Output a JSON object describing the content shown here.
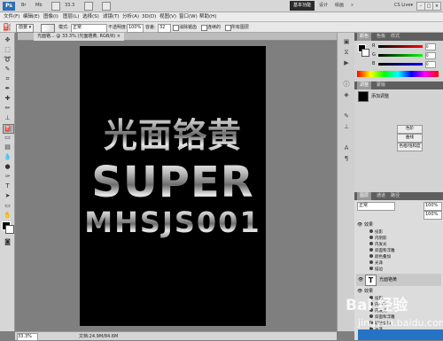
{
  "app": {
    "logo": "Ps",
    "top_buttons": [
      "Br",
      "Mb",
      "33.3",
      "▾",
      "▾",
      "▾"
    ],
    "workspace_active": "基本功能",
    "workspace_items": [
      "设计",
      "绘画",
      "»"
    ],
    "cs_live": "CS Live▾",
    "window_buttons": [
      "–",
      "□",
      "×"
    ]
  },
  "menu": [
    "文件(F)",
    "编辑(E)",
    "图像(I)",
    "图层(L)",
    "选择(S)",
    "滤镜(T)",
    "分析(A)",
    "3D(D)",
    "视图(V)",
    "窗口(W)",
    "帮助(H)"
  ],
  "options_bar": {
    "mode_label": "模式:",
    "mode_value": "正常",
    "opacity_label": "不透明度:",
    "opacity_value": "100%",
    "tolerance_label": "容差:",
    "tolerance_value": "32",
    "anti_alias": "消除锯齿",
    "contiguous": "连续的",
    "all_layers": "所有图层"
  },
  "doc_tab": {
    "title": "光面铬... @ 33.3% (光面铬黄, RGB/8) ×"
  },
  "canvas": {
    "line1": "光面铬黄",
    "line2": "SUPER",
    "line3": "MHSJS001"
  },
  "status": {
    "zoom": "33.3%",
    "doc": "文档:24.9M/84.6M"
  },
  "panels": {
    "color": {
      "tabs": [
        "颜色",
        "色板",
        "样式"
      ],
      "channels": [
        {
          "label": "R",
          "value": "0"
        },
        {
          "label": "G",
          "value": "0"
        },
        {
          "label": "B",
          "value": "0"
        }
      ]
    },
    "adjust": {
      "tabs": [
        "调整",
        "蒙版"
      ],
      "title": "添加调整",
      "buttons": [
        "色阶",
        "曲线",
        "色相/饱和度"
      ]
    },
    "layers": {
      "tabs": [
        "图层",
        "通道",
        "路径"
      ],
      "blend": "正常",
      "opacity": "100%",
      "fill": "100%",
      "effects_label": "效果",
      "layer1_fx": [
        "投影",
        "内阴影",
        "内发光",
        "斜面和浮雕",
        "颜色叠加",
        "光泽",
        "描边"
      ],
      "text_layer_name": "光面铬黄",
      "layer2_fx": [
        "投影",
        "内阴影",
        "内发光",
        "斜面和浮雕",
        "颜色叠加",
        "光泽"
      ]
    }
  },
  "watermark": {
    "main": "Bai 经验",
    "sub": "jingyan.baidu.com"
  }
}
